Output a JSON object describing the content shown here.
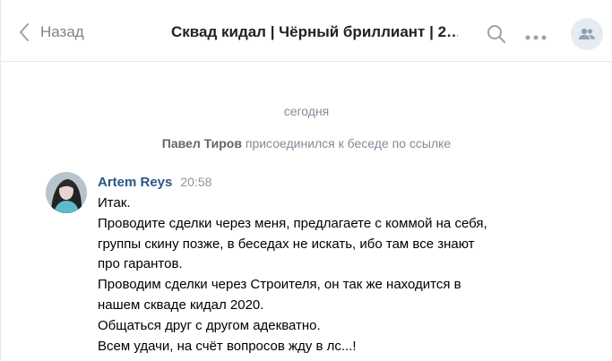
{
  "header": {
    "back_label": "Назад",
    "title": "Сквад кидал | Чёрный бриллиант | 2…"
  },
  "chat": {
    "date_separator": "сегодня",
    "service_message": {
      "user": "Павел Тиров",
      "text": "присоединился к беседе по ссылке"
    },
    "messages": [
      {
        "author": "Artem Reys",
        "time": "20:58",
        "lines": [
          "Итак.",
          "Проводите сделки через меня, предлагаете с коммой на себя,",
          "группы скину позже, в беседах не искать, ибо там все знают",
          "про гарантов.",
          "Проводим сделки через Строителя, он так же находится в",
          "нашем скваде кидал 2020.",
          "Общаться друг с другом адекватно.",
          "Всем удачи, на счёт вопросов жду в лс...!"
        ]
      }
    ]
  },
  "icons": {
    "back": "chevron-left-icon",
    "search": "search-icon",
    "more": "more-dots-icon",
    "members": "members-icon"
  },
  "colors": {
    "link": "#2a5885",
    "muted": "#818c99",
    "members_bg": "#e5ebf1"
  }
}
